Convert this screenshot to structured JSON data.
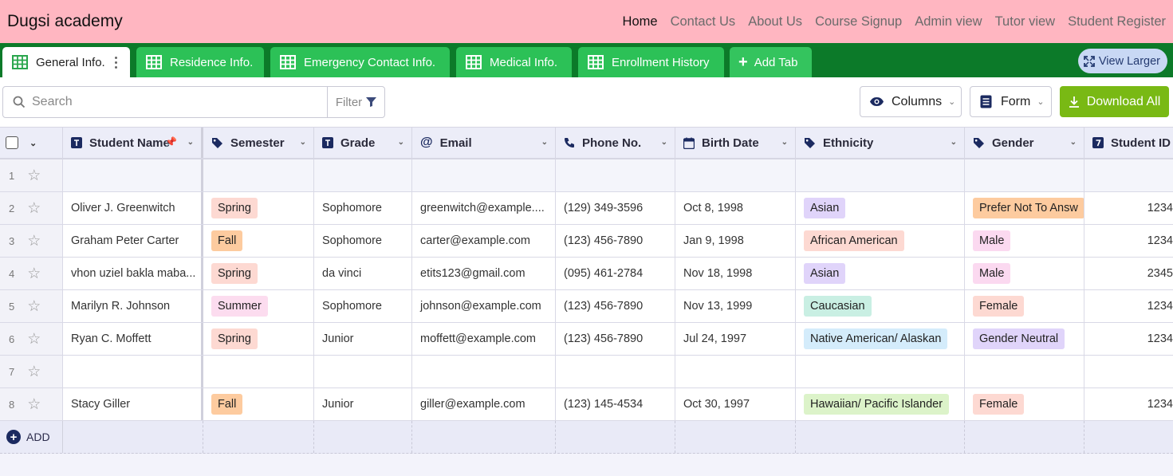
{
  "app": {
    "brand": "Dugsi academy"
  },
  "nav": [
    "Home",
    "Contact Us",
    "About Us",
    "Course Signup",
    "Admin view",
    "Tutor view",
    "Student Register"
  ],
  "tabs": [
    {
      "label": "General Info."
    },
    {
      "label": "Residence Info."
    },
    {
      "label": "Emergency Contact Info."
    },
    {
      "label": "Medical Info."
    },
    {
      "label": "Enrollment History"
    }
  ],
  "add_tab_label": "Add Tab",
  "view_larger_label": "View Larger",
  "toolbar": {
    "search_placeholder": "Search",
    "filter_label": "Filter",
    "columns_label": "Columns",
    "form_label": "Form",
    "download_label": "Download All"
  },
  "columns": [
    "Student Name",
    "Semester",
    "Grade",
    "Email",
    "Phone No.",
    "Birth Date",
    "Ethnicity",
    "Gender",
    "Student ID"
  ],
  "rows": [
    {
      "idx": "1",
      "name": "",
      "semester": "",
      "grade": "",
      "email": "",
      "phone": "",
      "birth": "",
      "ethnicity": "",
      "gender": "",
      "id": ""
    },
    {
      "idx": "2",
      "name": "Oliver J. Greenwitch",
      "semester": "Spring",
      "grade": "Sophomore",
      "email": "greenwitch@example....",
      "phone": "(129) 349-3596",
      "birth": "Oct 8, 1998",
      "ethnicity": "Asian",
      "gender": "Prefer Not To Answ",
      "id": "1234"
    },
    {
      "idx": "3",
      "name": "Graham Peter Carter",
      "semester": "Fall",
      "grade": "Sophomore",
      "email": "carter@example.com",
      "phone": "(123) 456-7890",
      "birth": "Jan 9, 1998",
      "ethnicity": "African American",
      "gender": "Male",
      "id": "1234"
    },
    {
      "idx": "4",
      "name": "vhon uziel bakla maba...",
      "semester": "Spring",
      "grade": "da vinci",
      "email": "etits123@gmail.com",
      "phone": "(095) 461-2784",
      "birth": "Nov 18, 1998",
      "ethnicity": "Asian",
      "gender": "Male",
      "id": "2345"
    },
    {
      "idx": "5",
      "name": "Marilyn R. Johnson",
      "semester": "Summer",
      "grade": "Sophomore",
      "email": "johnson@example.com",
      "phone": "(123) 456-7890",
      "birth": "Nov 13, 1999",
      "ethnicity": "Caucasian",
      "gender": "Female",
      "id": "1234"
    },
    {
      "idx": "6",
      "name": "Ryan C. Moffett",
      "semester": "Spring",
      "grade": "Junior",
      "email": "moffett@example.com",
      "phone": "(123) 456-7890",
      "birth": "Jul 24, 1997",
      "ethnicity": "Native American/ Alaskan",
      "gender": "Gender Neutral",
      "id": "1234"
    },
    {
      "idx": "7",
      "name": "",
      "semester": "",
      "grade": "",
      "email": "",
      "phone": "",
      "birth": "",
      "ethnicity": "",
      "gender": "",
      "id": ""
    },
    {
      "idx": "8",
      "name": "Stacy Giller",
      "semester": "Fall",
      "grade": "Junior",
      "email": "giller@example.com",
      "phone": "(123) 145-4534",
      "birth": "Oct 30, 1997",
      "ethnicity": "Hawaiian/ Pacific Islander",
      "gender": "Female",
      "id": "1234"
    }
  ],
  "add_row_label": "ADD",
  "tag_colors": {
    "Spring": "#fdd9d2",
    "Fall": "#fdcb9f",
    "Summer": "#fcdcef",
    "Asian": "#e0d4fa",
    "African American": "#fdd9d2",
    "Caucasian": "#c9efe3",
    "Native American/ Alaskan": "#d4ecfb",
    "Hawaiian/ Pacific Islander": "#dcf3c9",
    "Prefer Not To Answ": "#fdcb9f",
    "Male": "#fbd9f0",
    "Female": "#fdd9d2",
    "Gender Neutral": "#e0d4fa"
  },
  "colors": {
    "topbar": "#ffb6c1",
    "tabbar": "#0c7a29",
    "tab": "#2cc157",
    "download": "#79b914"
  }
}
